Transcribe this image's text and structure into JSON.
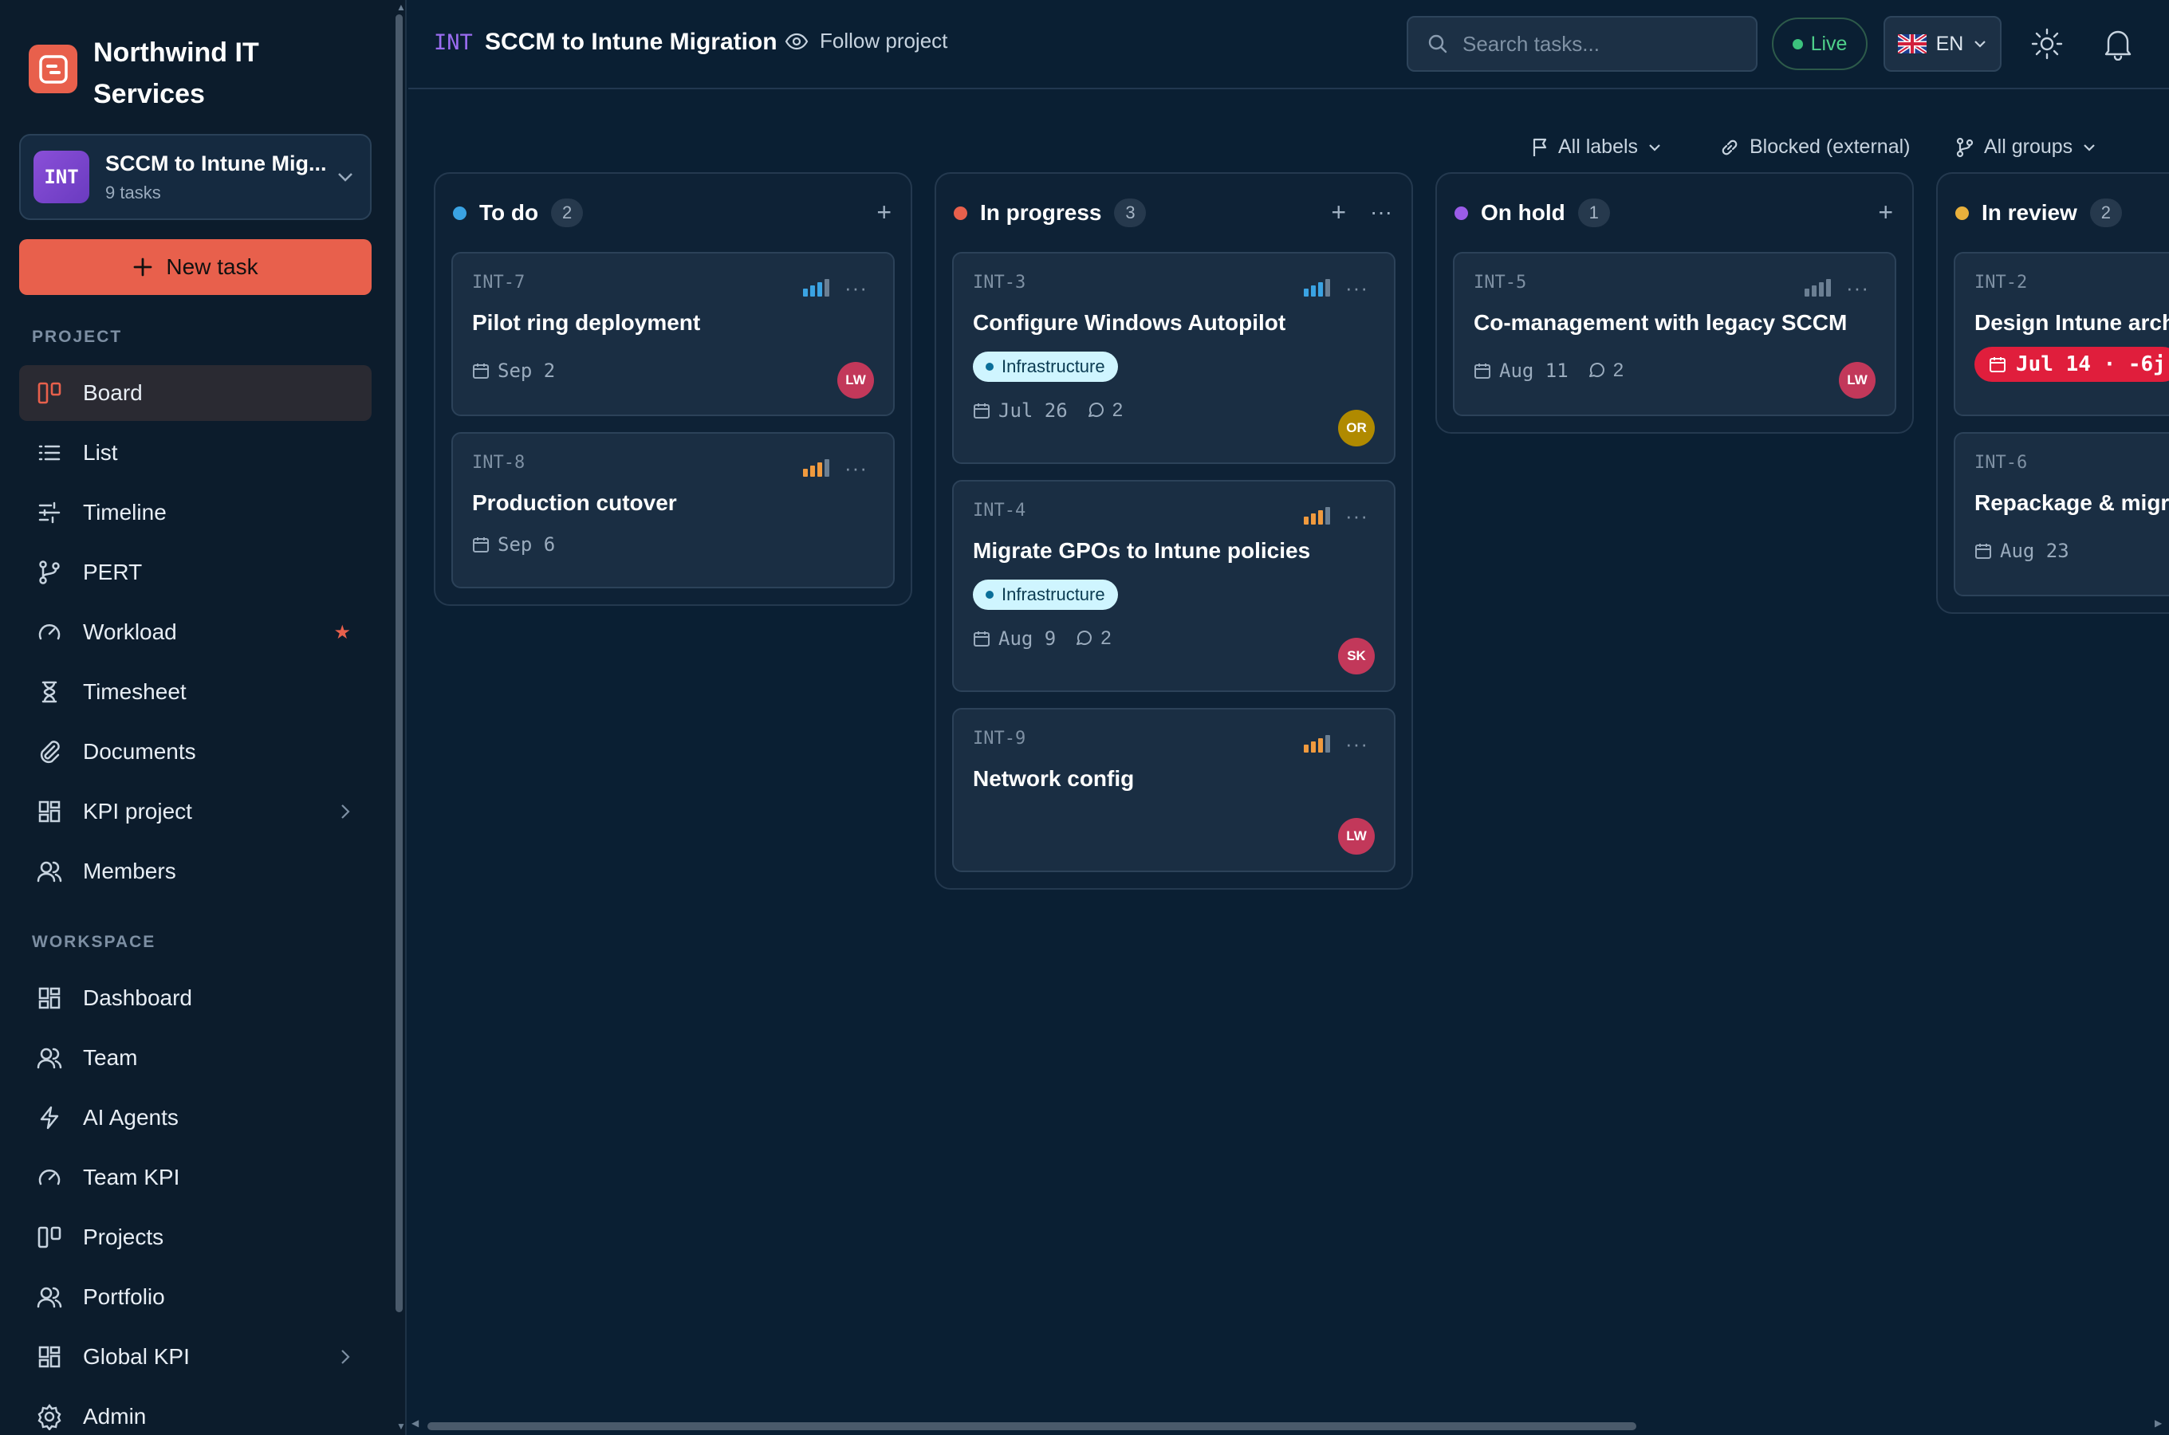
{
  "org": {
    "name": "Northwind IT Services",
    "icon": "logo-icon",
    "brand_color": "#e8604c"
  },
  "project_selector": {
    "badge": "INT",
    "name": "SCCM to Intune Mig...",
    "subtitle": "9 tasks"
  },
  "new_task_label": "New task",
  "sidebar": {
    "project_label": "PROJECT",
    "project_items": [
      {
        "label": "Board",
        "icon": "board-icon",
        "active": true
      },
      {
        "label": "List",
        "icon": "list-icon"
      },
      {
        "label": "Timeline",
        "icon": "timeline-icon"
      },
      {
        "label": "PERT",
        "icon": "pert-icon"
      },
      {
        "label": "Workload",
        "icon": "gauge-icon",
        "starred": true
      },
      {
        "label": "Timesheet",
        "icon": "hourglass-icon"
      },
      {
        "label": "Documents",
        "icon": "paperclip-icon"
      },
      {
        "label": "KPI project",
        "icon": "grid-icon",
        "has_submenu": true
      },
      {
        "label": "Members",
        "icon": "users-icon"
      }
    ],
    "workspace_label": "WORKSPACE",
    "workspace_items": [
      {
        "label": "Dashboard",
        "icon": "grid-icon"
      },
      {
        "label": "Team",
        "icon": "users-icon"
      },
      {
        "label": "AI Agents",
        "icon": "bolt-icon"
      },
      {
        "label": "Team KPI",
        "icon": "gauge-icon"
      },
      {
        "label": "Projects",
        "icon": "board-icon"
      },
      {
        "label": "Portfolio",
        "icon": "users-icon"
      },
      {
        "label": "Global KPI",
        "icon": "grid-icon",
        "has_submenu": true
      },
      {
        "label": "Admin",
        "icon": "gear-icon"
      }
    ]
  },
  "header": {
    "project_key": "INT",
    "project_title": "SCCM to Intune Migration",
    "follow_label": "Follow project",
    "search_placeholder": "Search tasks...",
    "live_label": "Live",
    "language": "EN"
  },
  "filters": {
    "labels": "All labels",
    "blocked": "Blocked (external)",
    "groups": "All groups"
  },
  "columns": [
    {
      "title": "To do",
      "count": "2",
      "color": "#3aa3e3",
      "cards": [
        {
          "id": "INT-7",
          "title": "Pilot ring deployment",
          "priority": "low",
          "date": "Sep 2",
          "avatar": "LW",
          "avatar_color": "#c2385a"
        },
        {
          "id": "INT-8",
          "title": "Production cutover",
          "priority": "high",
          "date": "Sep 6"
        }
      ]
    },
    {
      "title": "In progress",
      "count": "3",
      "color": "#e8604c",
      "cards": [
        {
          "id": "INT-3",
          "title": "Configure Windows Autopilot",
          "priority": "low",
          "tag": "Infrastructure",
          "date": "Jul 26",
          "comments": "2",
          "avatar": "OR",
          "avatar_color": "#b08a00"
        },
        {
          "id": "INT-4",
          "title": "Migrate GPOs to Intune policies",
          "priority": "high",
          "tag": "Infrastructure",
          "date": "Aug 9",
          "comments": "2",
          "avatar": "SK",
          "avatar_color": "#c2385a"
        },
        {
          "id": "INT-9",
          "title": "Network config",
          "priority": "high",
          "avatar": "LW",
          "avatar_color": "#c2385a"
        }
      ]
    },
    {
      "title": "On hold",
      "count": "1",
      "color": "#9a5ce8",
      "cards": [
        {
          "id": "INT-5",
          "title": "Co-management with legacy SCCM",
          "priority": "none",
          "date": "Aug 11",
          "comments": "2",
          "avatar": "LW",
          "avatar_color": "#c2385a"
        }
      ]
    },
    {
      "title": "In review",
      "count": "2",
      "color": "#e8b03c",
      "cards": [
        {
          "id": "INT-2",
          "title": "Design Intune architecture",
          "overdue": "Jul 14 · -6j"
        },
        {
          "id": "INT-6",
          "title": "Repackage & migrate apps",
          "date": "Aug 23"
        }
      ]
    }
  ]
}
